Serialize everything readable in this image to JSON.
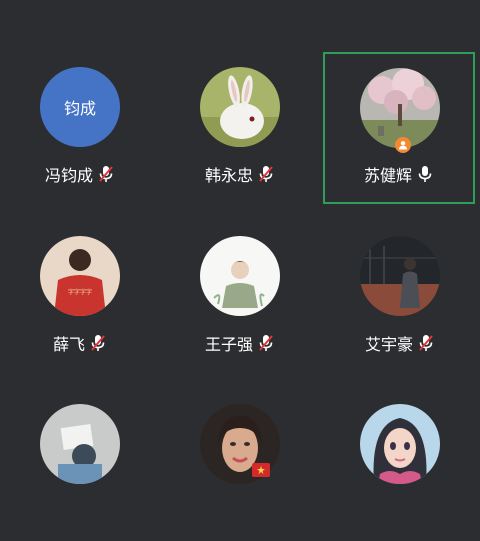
{
  "participants": [
    {
      "name": "冯钧成",
      "avatar_text": "钧成",
      "avatar_icon": "initials-avatar",
      "mic_icon": "mic-muted-icon",
      "selected": false
    },
    {
      "name": "韩永忠",
      "avatar_icon": "rabbit-photo",
      "mic_icon": "mic-muted-icon",
      "selected": false
    },
    {
      "name": "苏健辉",
      "avatar_icon": "blossom-tree-photo",
      "mic_icon": "mic-icon",
      "selected": true,
      "host_badge_icon": "host-person-icon"
    },
    {
      "name": "薛飞",
      "avatar_icon": "red-shirt-photo",
      "mic_icon": "mic-muted-icon",
      "selected": false
    },
    {
      "name": "王子强",
      "avatar_icon": "boy-sketch-photo",
      "mic_icon": "mic-muted-icon",
      "selected": false
    },
    {
      "name": "艾宇豪",
      "avatar_icon": "court-night-photo",
      "mic_icon": "mic-muted-icon",
      "selected": false
    },
    {
      "name": "",
      "avatar_icon": "reader-photo",
      "mic_icon": "",
      "selected": false
    },
    {
      "name": "",
      "avatar_icon": "woman-photo",
      "mic_icon": "",
      "selected": false
    },
    {
      "name": "",
      "avatar_icon": "anime-girl-photo",
      "mic_icon": "",
      "selected": false
    }
  ],
  "colors": {
    "background": "#2c2d30",
    "selected_border": "#2f9e58",
    "muted_slash": "#e5343a",
    "initials_avatar_bg": "#4574c6",
    "host_badge": "#f28a30"
  }
}
